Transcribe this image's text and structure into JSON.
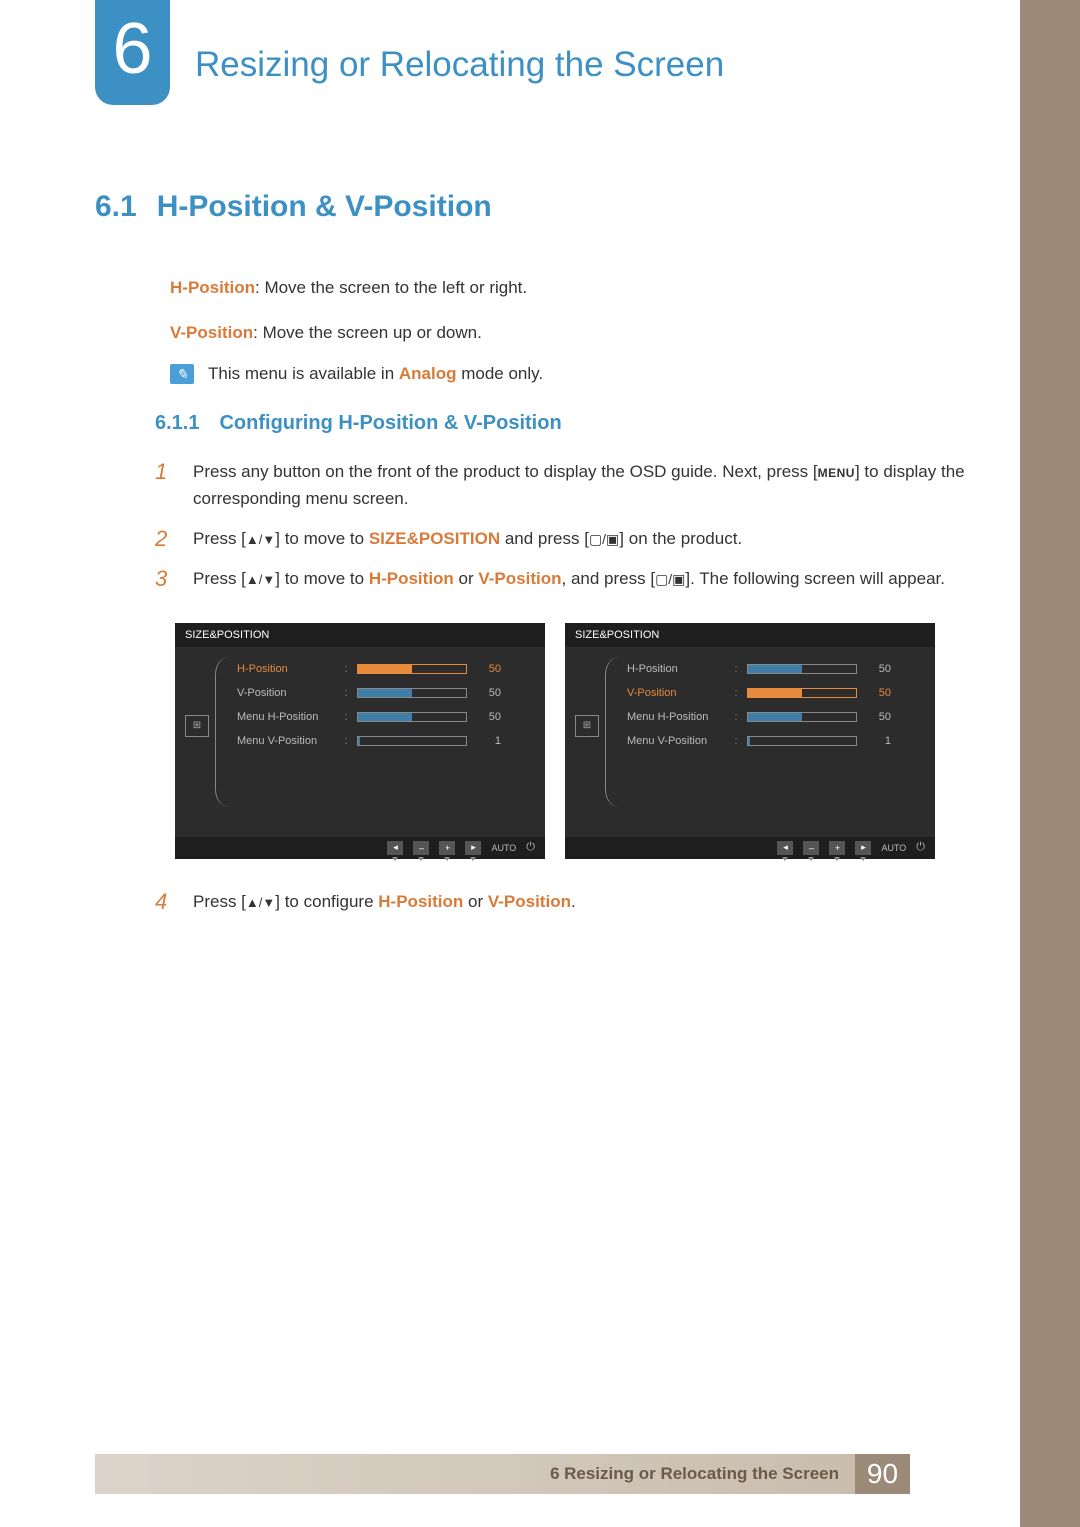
{
  "chapter": {
    "number": "6",
    "title": "Resizing or Relocating the Screen"
  },
  "section": {
    "number": "6.1",
    "title": "H-Position & V-Position",
    "hpos_label": "H-Position",
    "hpos_desc": ": Move the screen to the left or right.",
    "vpos_label": "V-Position",
    "vpos_desc": ": Move the screen up or down.",
    "note_pre": "This menu is available in ",
    "note_mode": "Analog",
    "note_post": " mode only."
  },
  "subsection": {
    "number": "6.1.1",
    "title": "Configuring H-Position & V-Position"
  },
  "steps": {
    "s1_num": "1",
    "s1_a": "Press any button on the front of the product to display the OSD guide. Next, press [",
    "s1_menu": "MENU",
    "s1_b": "] to display the corresponding menu screen.",
    "s2_num": "2",
    "s2_a": "Press [",
    "s2_arrows": "▲/▼",
    "s2_b": "] to move to ",
    "s2_target": "SIZE&POSITION",
    "s2_c": " and press [",
    "s2_box": "▢/▣",
    "s2_d": "] on the product.",
    "s3_num": "3",
    "s3_a": "Press [",
    "s3_arrows": "▲/▼",
    "s3_b": "] to move to ",
    "s3_h": "H-Position",
    "s3_or1": " or ",
    "s3_v": "V-Position",
    "s3_c": ", and press [",
    "s3_box": "▢/▣",
    "s3_d": "]. The following screen will appear.",
    "s4_num": "4",
    "s4_a": "Press [",
    "s4_arrows": "▲/▼",
    "s4_b": "] to configure ",
    "s4_h": "H-Position",
    "s4_or": " or ",
    "s4_v": "V-Position",
    "s4_c": "."
  },
  "osd": {
    "header": "SIZE&POSITION",
    "items": [
      {
        "label": "H-Position",
        "value": "50",
        "fill": 50
      },
      {
        "label": "V-Position",
        "value": "50",
        "fill": 50
      },
      {
        "label": "Menu H-Position",
        "value": "50",
        "fill": 50
      },
      {
        "label": "Menu V-Position",
        "value": "1",
        "fill": 2
      }
    ],
    "footer": {
      "back": "◂",
      "minus": "–",
      "plus": "+",
      "play": "▸",
      "auto": "AUTO",
      "power": "⏻"
    },
    "left_active_index": 0,
    "right_active_index": 1
  },
  "footer": {
    "chapter_num": "6",
    "chapter_title": "Resizing or Relocating the Screen",
    "page": "90"
  }
}
